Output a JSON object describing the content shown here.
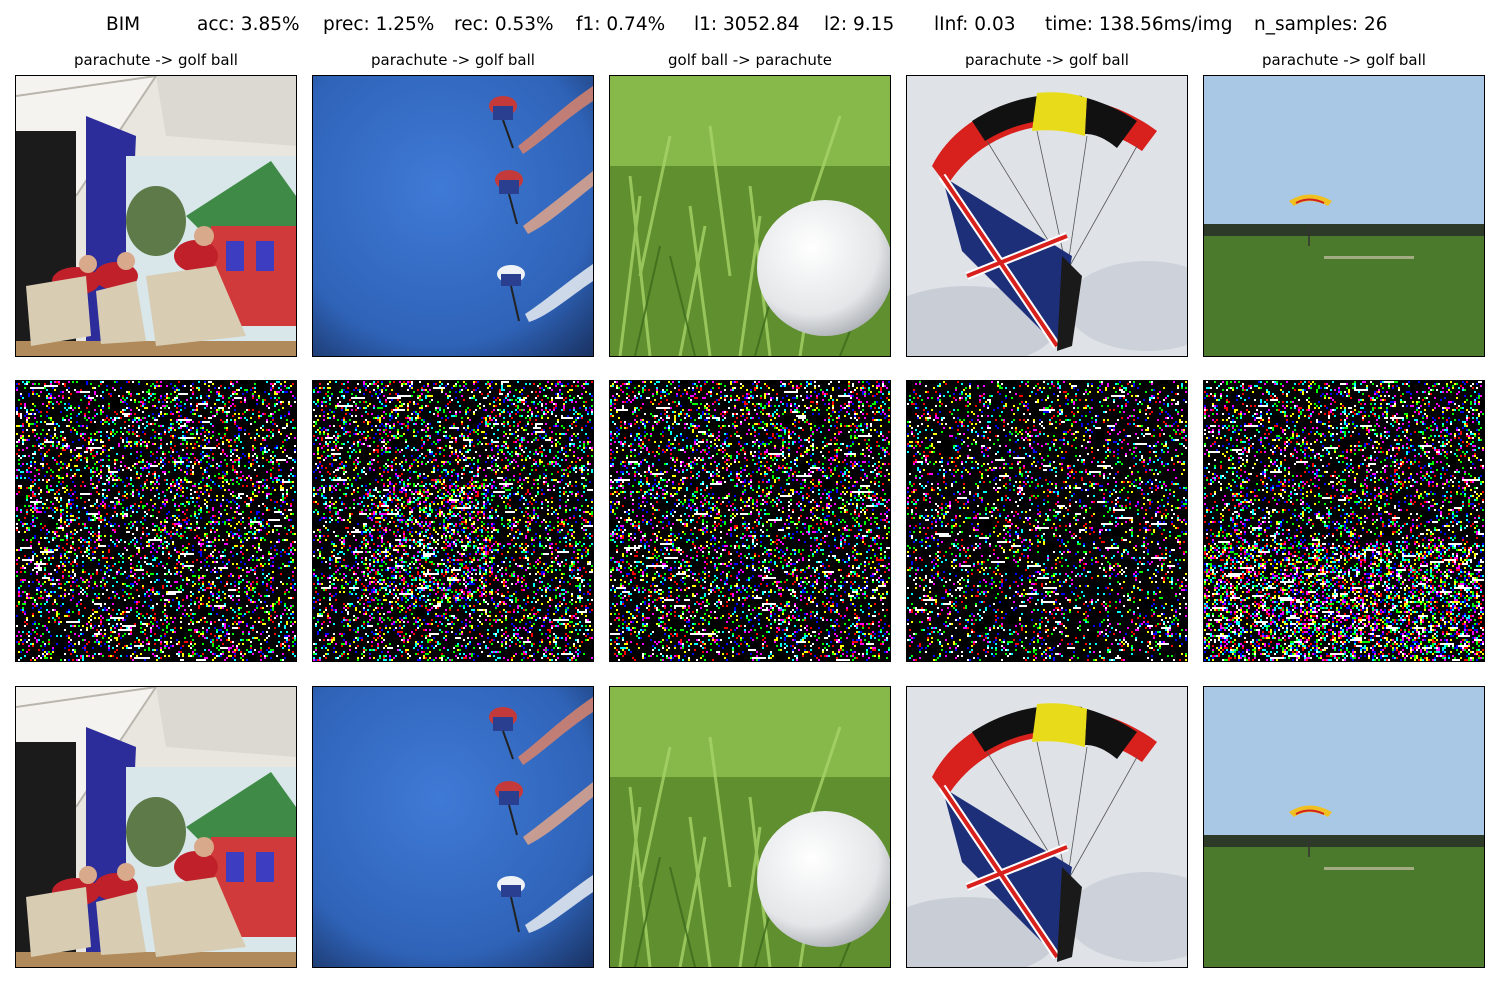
{
  "header": {
    "method": "BIM",
    "acc": "acc: 3.85%",
    "prec": "prec: 1.25%",
    "rec": "rec: 0.53%",
    "f1": "f1: 0.74%",
    "l1": "l1: 3052.84",
    "l2": "l2: 9.15",
    "linf": "lInf: 0.03",
    "time": "time: 138.56ms/img",
    "n_samples": "n_samples: 26"
  },
  "columns": [
    {
      "title": "parachute -> golf ball",
      "scene": "performers on stage"
    },
    {
      "title": "parachute -> golf ball",
      "scene": "skydivers with smoke trails"
    },
    {
      "title": "golf ball -> parachute",
      "scene": "golf ball in grass"
    },
    {
      "title": "parachute -> golf ball",
      "scene": "parachute with union jack"
    },
    {
      "title": "parachute -> golf ball",
      "scene": "parachute over field"
    }
  ],
  "rows": [
    "original",
    "perturbation",
    "adversarial"
  ]
}
